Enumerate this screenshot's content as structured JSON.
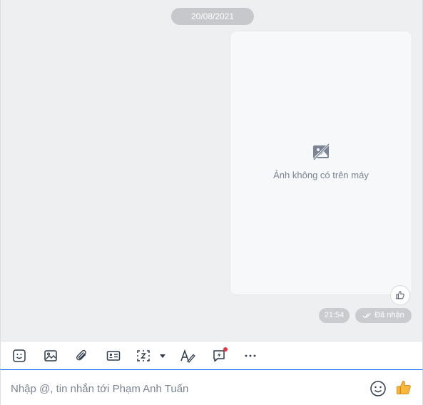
{
  "chat": {
    "date_separator": "20/08/2021",
    "image_message": {
      "placeholder_text": "Ảnh không có trên máy",
      "placeholder_icon": "broken-image-icon",
      "reaction_icon": "thumbs-up-outline-icon"
    },
    "time": "21:54",
    "status": "Đã nhận",
    "status_icon": "double-check-icon"
  },
  "toolbar": {
    "items": [
      {
        "name": "sticker-icon"
      },
      {
        "name": "image-icon"
      },
      {
        "name": "attachment-icon"
      },
      {
        "name": "contact-card-icon"
      },
      {
        "name": "screenshot-icon"
      },
      {
        "name": "text-format-icon"
      },
      {
        "name": "quick-message-icon"
      },
      {
        "name": "more-icon"
      }
    ]
  },
  "composer": {
    "placeholder": "Nhập @, tin nhắn tới Phạm Anh Tuấn",
    "emoji_icon": "smiley-icon",
    "send_icon": "thumbs-up-icon"
  },
  "colors": {
    "accent": "#0068ff",
    "chat_background": "#eeeff1",
    "icon": "#2c3a4b",
    "pill": "#c6c8cb",
    "notification": "#e5333b"
  }
}
